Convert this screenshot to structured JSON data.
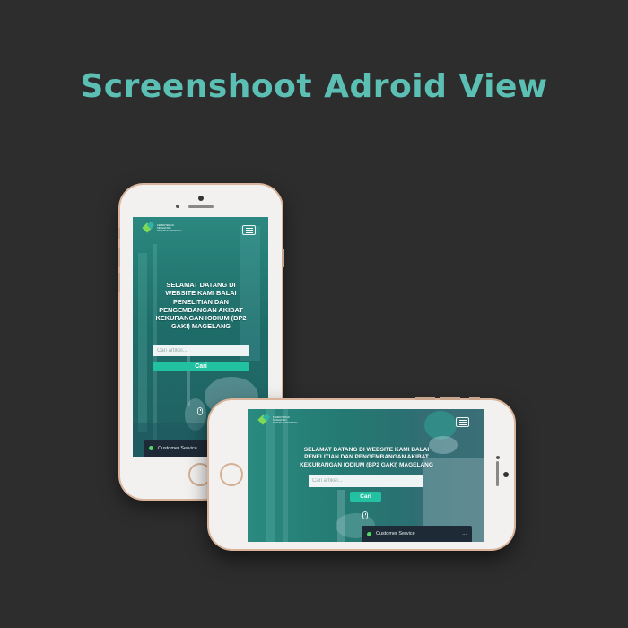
{
  "headline": "Screenshoot Adroid View",
  "site": {
    "logo_text": "KEMENTERIAN KESEHATAN REPUBLIK INDONESIA",
    "hero_title": "SELAMAT DATANG DI WEBSITE KAMI BALAI PENELITIAN DAN PENGEMBANGAN AKIBAT KEKURANGAN IODIUM (BP2 GAKI) MAGELANG",
    "search_placeholder": "Cari artikel...",
    "search_button": "Cari",
    "customer_service": "Customer Service",
    "minimize_label": "..."
  },
  "colors": {
    "background": "#2d2d2d",
    "headline": "#5bbfb4",
    "accent_button": "#21c1a1",
    "phone_body": "#f3f1f0",
    "phone_trim": "#d9b49a",
    "chat_bar": "#1e2b36",
    "status_online": "#4cd964"
  },
  "icons": {
    "menu": "hamburger-icon",
    "scroll": "mouse-scroll-icon",
    "status": "online-dot-icon"
  }
}
